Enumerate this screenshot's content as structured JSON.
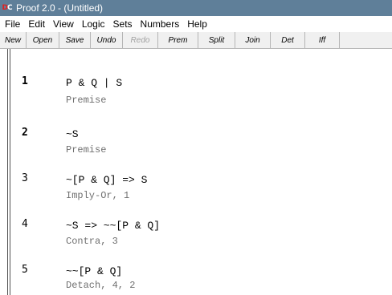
{
  "window": {
    "title": "Proof 2.0 - (Untitled)",
    "icon": "proof-app-icon",
    "icon_text_1": "D",
    "icon_text_2": "C"
  },
  "menu": {
    "items": [
      "File",
      "Edit",
      "View",
      "Logic",
      "Sets",
      "Numbers",
      "Help"
    ]
  },
  "toolbar": {
    "buttons": [
      {
        "label": "New",
        "enabled": true
      },
      {
        "label": "Open",
        "enabled": true
      },
      {
        "label": "Save",
        "enabled": true
      },
      {
        "label": "Undo",
        "enabled": true
      },
      {
        "label": "Redo",
        "enabled": false
      },
      {
        "label": "Prem",
        "enabled": true
      },
      {
        "label": "Split",
        "enabled": true
      },
      {
        "label": "Join",
        "enabled": true
      },
      {
        "label": "Det",
        "enabled": true
      },
      {
        "label": "Iff",
        "enabled": true
      }
    ]
  },
  "proof": {
    "steps": [
      {
        "number": "1",
        "formula": "P & Q | S",
        "reason": "Premise",
        "bold": true
      },
      {
        "number": "2",
        "formula": "~S",
        "reason": "Premise",
        "bold": true
      },
      {
        "number": "3",
        "formula": "~[P & Q] => S",
        "reason": "Imply-Or, 1",
        "bold": false
      },
      {
        "number": "4",
        "formula": "~S => ~~[P & Q]",
        "reason": "Contra, 3",
        "bold": false
      },
      {
        "number": "5",
        "formula": "~~[P & Q]",
        "reason": "Detach, 4, 2",
        "bold": false
      }
    ]
  }
}
